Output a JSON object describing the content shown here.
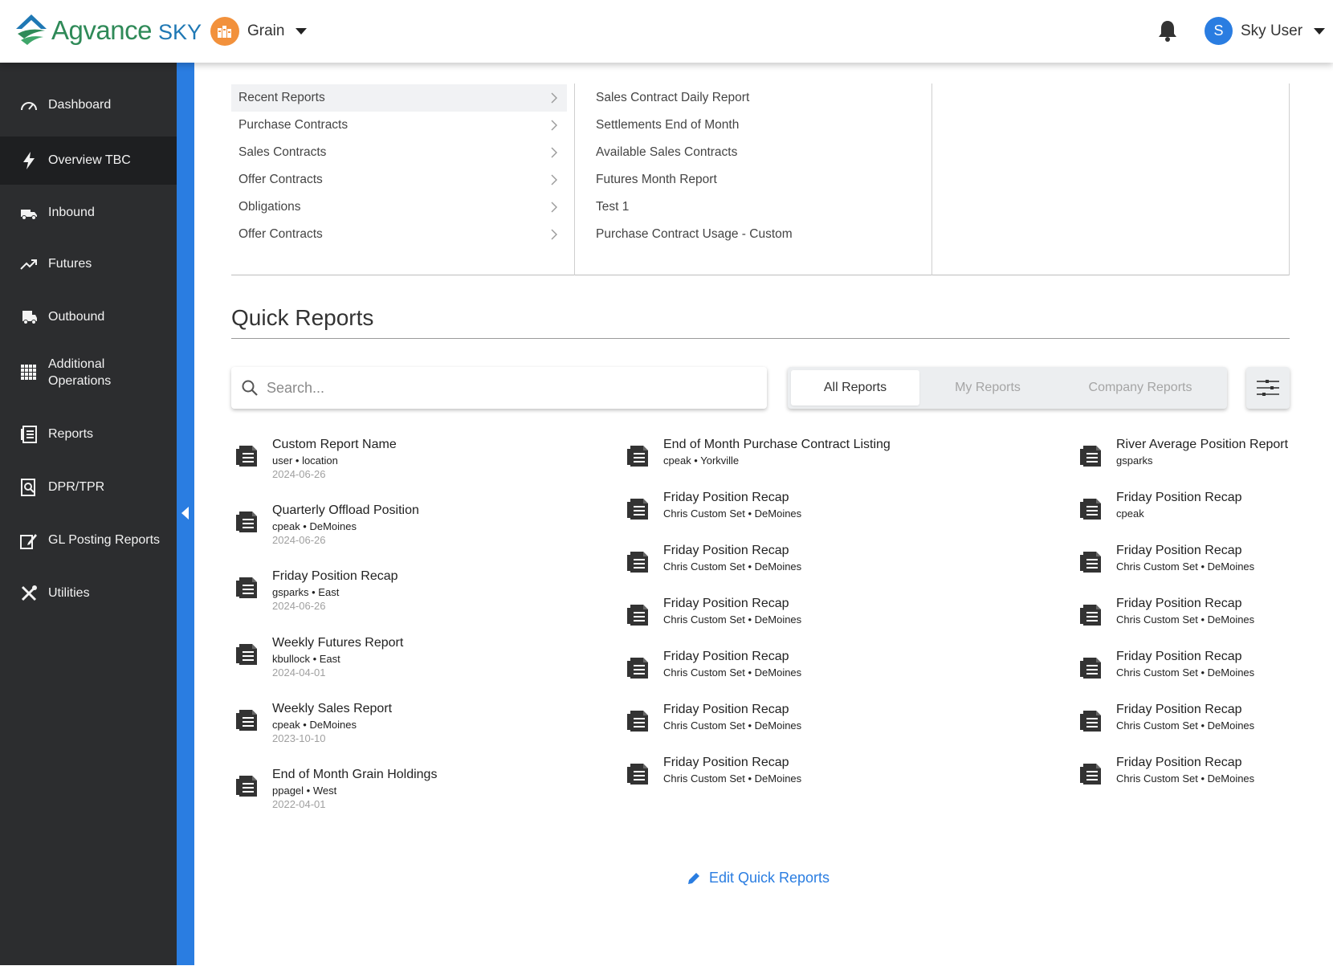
{
  "brand": {
    "name": "Agvance",
    "sky": "SKY",
    "colors": {
      "green": "#2f8a58",
      "blue": "#1f78b4"
    }
  },
  "header": {
    "module": {
      "label": "Grain",
      "icon": "grain-elevator-icon"
    },
    "user": {
      "initial": "S",
      "name": "Sky User"
    }
  },
  "sidebar": {
    "items": [
      {
        "label": "Dashboard",
        "icon": "speedometer-icon"
      },
      {
        "label": "Overview TBC",
        "icon": "lightning-icon",
        "active": true
      },
      {
        "label": "Inbound",
        "icon": "truck-icon"
      },
      {
        "label": "Futures",
        "icon": "trending-up-icon"
      },
      {
        "label": "Outbound",
        "icon": "truck-outbound-icon"
      },
      {
        "label": "Additional Operations",
        "icon": "grid-icon"
      },
      {
        "label": "Reports",
        "icon": "report-icon"
      },
      {
        "label": "DPR/TPR",
        "icon": "document-search-icon"
      },
      {
        "label": "GL Posting Reports",
        "icon": "edit-document-icon"
      },
      {
        "label": "Utilities",
        "icon": "tools-icon"
      }
    ]
  },
  "categories": [
    "Recent Reports",
    "Purchase Contracts",
    "Sales Contracts",
    "Offer Contracts",
    "Obligations",
    "Offer Contracts"
  ],
  "recent_reports": [
    "Sales Contract Daily Report",
    "Settlements End of Month",
    "Available Sales Contracts",
    "Futures Month Report",
    "Test 1",
    "Purchase Contract Usage - Custom"
  ],
  "quick_reports": {
    "title": "Quick Reports",
    "search_placeholder": "Search...",
    "tabs": [
      "All Reports",
      "My Reports",
      "Company Reports"
    ],
    "edit_label": "Edit Quick Reports",
    "col1": [
      {
        "title": "Custom Report Name",
        "meta": "user • location",
        "date": "2024-06-26"
      },
      {
        "title": "Quarterly Offload Position",
        "meta": "cpeak • DeMoines",
        "date": "2024-06-26"
      },
      {
        "title": "Friday Position Recap",
        "meta": "gsparks • East",
        "date": "2024-06-26"
      },
      {
        "title": "Weekly Futures Report",
        "meta": "kbullock • East",
        "date": "2024-04-01"
      },
      {
        "title": "Weekly Sales Report",
        "meta": "cpeak • DeMoines",
        "date": "2023-10-10"
      },
      {
        "title": "End of Month Grain Holdings",
        "meta": "ppagel • West",
        "date": "2022-04-01"
      }
    ],
    "col2": [
      {
        "title": "End of Month Purchase Contract Listing",
        "meta": "cpeak • Yorkville"
      },
      {
        "title": "Friday Position Recap",
        "meta": "Chris Custom Set • DeMoines"
      },
      {
        "title": "Friday Position Recap",
        "meta": "Chris Custom Set • DeMoines"
      },
      {
        "title": "Friday Position Recap",
        "meta": "Chris Custom Set • DeMoines"
      },
      {
        "title": "Friday Position Recap",
        "meta": "Chris Custom Set • DeMoines"
      },
      {
        "title": "Friday Position Recap",
        "meta": "Chris Custom Set • DeMoines"
      },
      {
        "title": "Friday Position Recap",
        "meta": "Chris Custom Set • DeMoines"
      }
    ],
    "col3": [
      {
        "title": "River Average Position Report",
        "meta": "gsparks"
      },
      {
        "title": "Friday Position Recap",
        "meta": "cpeak"
      },
      {
        "title": "Friday Position Recap",
        "meta": "Chris Custom Set • DeMoines"
      },
      {
        "title": "Friday Position Recap",
        "meta": "Chris Custom Set • DeMoines"
      },
      {
        "title": "Friday Position Recap",
        "meta": "Chris Custom Set • DeMoines"
      },
      {
        "title": "Friday Position Recap",
        "meta": "Chris Custom Set • DeMoines"
      },
      {
        "title": "Friday Position Recap",
        "meta": "Chris Custom Set • DeMoines"
      }
    ]
  }
}
